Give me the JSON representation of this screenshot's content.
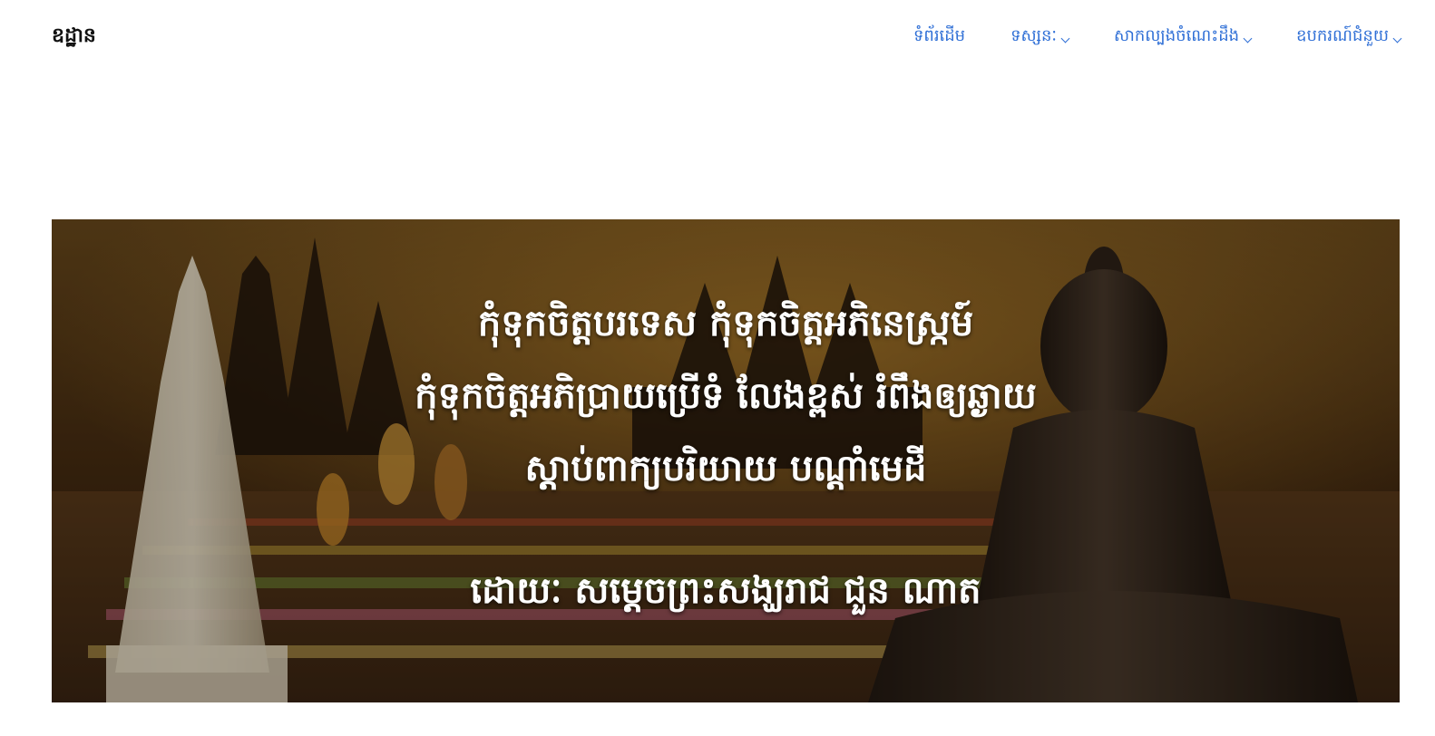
{
  "header": {
    "brand": "ឧដ្ឋាន",
    "nav": [
      {
        "label": "ទំព័រដើម",
        "has_dropdown": false
      },
      {
        "label": "ទស្សនៈ",
        "has_dropdown": true
      },
      {
        "label": "សាកល្បងចំណេះដឹង",
        "has_dropdown": true
      },
      {
        "label": "ឧបករណ៍ជំនួយ",
        "has_dropdown": true
      }
    ],
    "link_color": "#2f6fd6"
  },
  "hero": {
    "lines": [
      "កុំទុកចិត្តបរទេស កុំទុកចិត្តអភិនេស្រ្កម៍",
      "កុំទុកចិត្តអភិប្រាយប្រើទំ លែងខ្ពស់ រំពឹងឲ្យឆ្ងាយ",
      "ស្តាប់ពាក្យបរិយាយ បណ្តាំមេដី"
    ],
    "author": "ដោយៈ សម្តេចព្រះសង្ឃរាជ ជួន ណាត",
    "image_subject": "temple-festival-buddha-banner"
  }
}
